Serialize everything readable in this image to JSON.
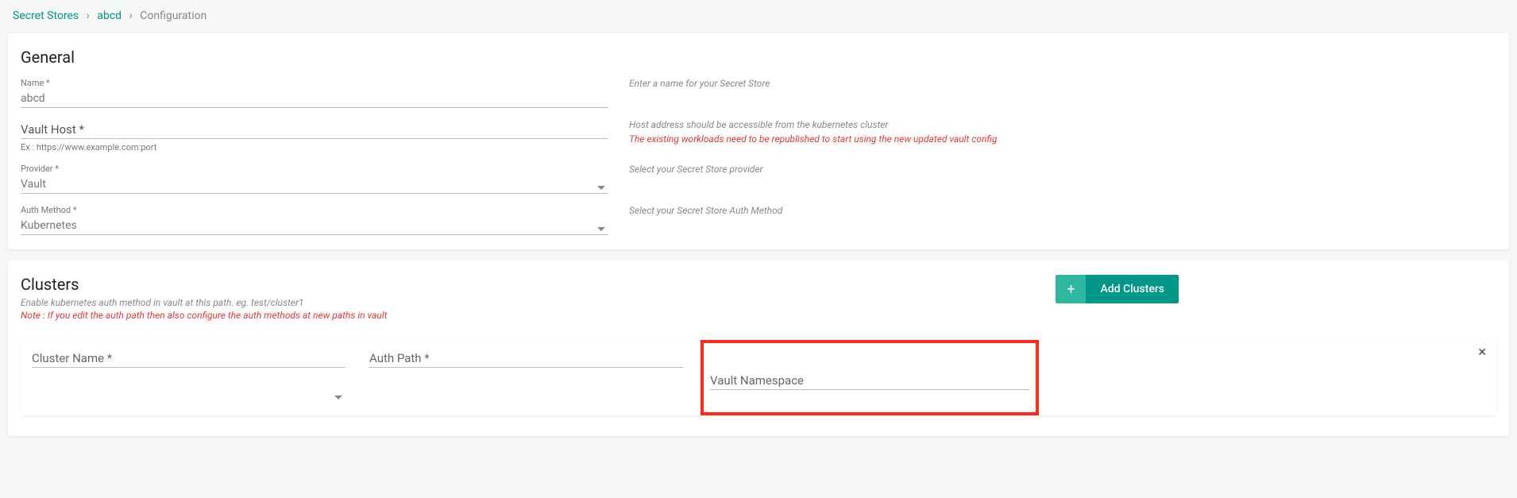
{
  "breadcrumb": {
    "root": "Secret Stores",
    "item": "abcd",
    "current": "Configuration"
  },
  "general": {
    "title": "General",
    "name_label": "Name *",
    "name_value": "abcd",
    "name_help": "Enter a name for your Secret Store",
    "host_label": "Vault Host *",
    "host_hint": "Ex : https://www.example.com:port",
    "host_help": "Host address should be accessible from the kubernetes cluster",
    "host_warn": "The existing workloads need to be republished to start using the new updated vault config",
    "provider_label": "Provider *",
    "provider_value": "Vault",
    "provider_help": "Select your Secret Store provider",
    "auth_label": "Auth Method *",
    "auth_value": "Kubernetes",
    "auth_help": "Select your Secret Store Auth Method"
  },
  "clusters": {
    "title": "Clusters",
    "subtitle": "Enable kubernetes auth method in vault at this path. eg. test/cluster1",
    "note": "Note : If you edit the auth path then also configure the auth methods at new paths in vault",
    "add_button": "Add Clusters",
    "row": {
      "cluster_name_label": "Cluster Name *",
      "auth_path_label": "Auth Path *",
      "vault_ns_label": "Vault Namespace"
    }
  }
}
